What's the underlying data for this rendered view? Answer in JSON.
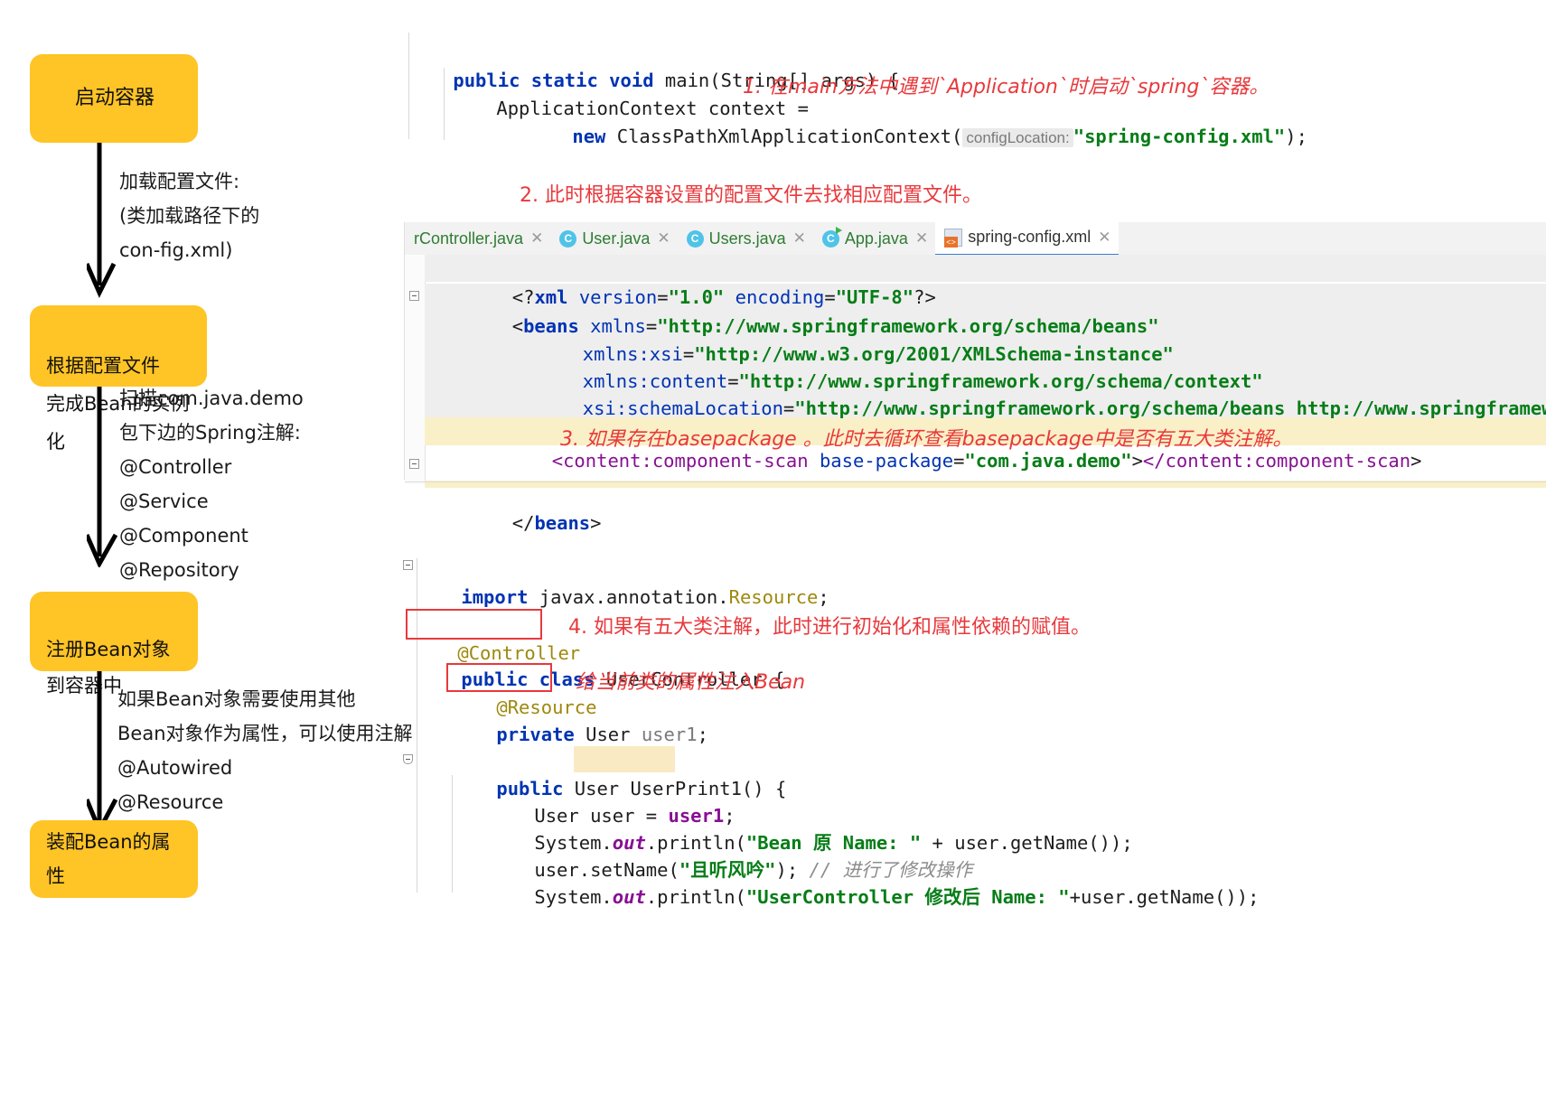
{
  "flowchart": {
    "nodes": [
      {
        "id": "start-container",
        "label": "启动容器"
      },
      {
        "id": "instantiate-bean",
        "label": "根据配置文件\n完成Bean的实例化"
      },
      {
        "id": "register-bean",
        "label": "注册Bean对象\n到容器中"
      },
      {
        "id": "assemble-bean",
        "label": "装配Bean的属性"
      }
    ],
    "edge_labels": [
      {
        "id": "load-config",
        "text": "加载配置文件:\n(类加载路径下的\ncon-fig.xml)"
      },
      {
        "id": "scan-annotations",
        "text": "扫描com.java.demo\n包下边的Spring注解:\n@Controller\n@Service\n@Component\n@Repository"
      },
      {
        "id": "inject-annotations",
        "text": "如果Bean对象需要使用其他\nBean对象作为属性，可以使用注解\n@Autowired\n@Resource"
      }
    ]
  },
  "annotations": {
    "note1": "1. 在main方法中遇到`Application`时启动`spring`容器。",
    "note2": "2. 此时根据容器设置的配置文件去找相应配置文件。",
    "note3": "3. 如果存在basepackage 。此时去循环查看basepackage中是否有五大类注解。",
    "note4": "4. 如果有五大类注解，此时进行初始化和属性依赖的赋值。",
    "note5": "给当前类的属性注入Bean"
  },
  "main_code": {
    "line1_kw": "public static void",
    "line1_rest": " main(String[] args) {",
    "line2": "ApplicationContext context = ",
    "line3_new": "new",
    "line3_cls": " ClassPathXmlApplicationContext(",
    "line3_param": "configLocation:",
    "line3_str": "\"spring-config.xml\"",
    "line3_end": ");"
  },
  "ide": {
    "tabs": [
      {
        "label": "rController.java",
        "icon": "java-class-icon",
        "closable": true,
        "active": false,
        "truncated": true
      },
      {
        "label": "User.java",
        "icon": "java-class-icon",
        "closable": true,
        "active": false
      },
      {
        "label": "Users.java",
        "icon": "java-class-icon",
        "closable": true,
        "active": false
      },
      {
        "label": "App.java",
        "icon": "java-runnable-class-icon",
        "closable": true,
        "active": false
      },
      {
        "label": "spring-config.xml",
        "icon": "xml-file-icon",
        "closable": true,
        "active": true
      }
    ],
    "xml_lines": [
      {
        "id": "xml-decl",
        "text": "<?xml version=\"1.0\" encoding=\"UTF-8\"?>"
      },
      {
        "id": "beans-open",
        "text": "<beans xmlns=\"http://www.springframework.org/schema/beans\""
      },
      {
        "id": "xmlns-xsi",
        "text": "xmlns:xsi=\"http://www.w3.org/2001/XMLSchema-instance\""
      },
      {
        "id": "xmlns-content",
        "text": "xmlns:content=\"http://www.springframework.org/schema/context\""
      },
      {
        "id": "schema-location",
        "text": "xsi:schemaLocation=\"http://www.springframework.org/schema/beans http://www.springframework.o"
      },
      {
        "id": "component-scan",
        "text": "<content:component-scan base-package=\"com.java.demo\"></content:component-scan>"
      },
      {
        "id": "beans-close",
        "text": "</beans>"
      }
    ]
  },
  "java_code": {
    "import_kw": "import",
    "import_rest": " javax.annotation.",
    "import_cls": "Resource",
    "import_semi": ";",
    "ann_controller": "@Controller",
    "class_kw": "public class",
    "class_name": " UserController {",
    "ann_resource": "@Resource",
    "field_kw": "private",
    "field_rest": " User ",
    "field_name": "user1",
    "field_semi": ";",
    "method_kw": "public",
    "method_type": " User ",
    "method_name": "UserPrint1",
    "method_tail": "() {",
    "l_user_assign_a": "User user = ",
    "l_user_assign_b": "user1",
    "l_user_assign_c": ";",
    "l_print1_a": "System.",
    "l_print1_out": "out",
    "l_print1_b": ".println(",
    "l_print1_str": "\"Bean 原 Name: \"",
    "l_print1_c": " + user.getName());",
    "l_set_a": "user.setName(",
    "l_set_str": "\"且听风吟\"",
    "l_set_b": "); ",
    "l_set_comment": "// 进行了修改操作",
    "l_print2_a": "System.",
    "l_print2_out": "out",
    "l_print2_b": ".println(",
    "l_print2_str": "\"UserController 修改后 Name: \"",
    "l_print2_c": "+user.getName());"
  },
  "colors": {
    "node_fill": "#FFC425",
    "note_red": "#e8393c",
    "keyword_blue": "#0033b3",
    "string_green": "#067d17",
    "annotation_olive": "#9e880d",
    "highlight_yellow": "#faf0c8"
  }
}
